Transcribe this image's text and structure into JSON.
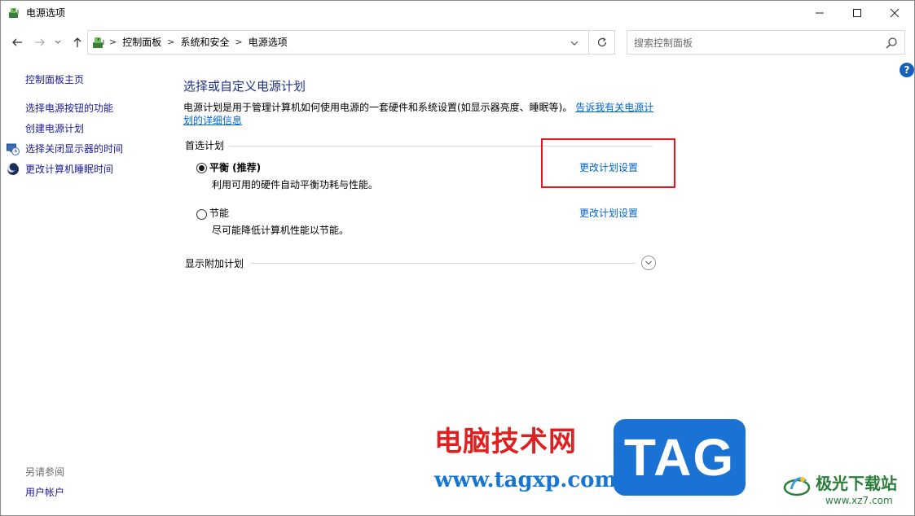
{
  "window": {
    "title": "电源选项",
    "icon": "power-options-icon",
    "controls": [
      "minimize-icon",
      "maximize-icon",
      "close-icon"
    ]
  },
  "nav": {
    "back_icon": "back-arrow-icon",
    "forward_icon": "forward-arrow-icon",
    "recent_icon": "chevron-down-icon",
    "up_icon": "up-arrow-icon"
  },
  "address": {
    "breadcrumbs": [
      "控制面板",
      "系统和安全",
      "电源选项"
    ],
    "separator": ">",
    "dropdown_icon": "chevron-down-icon",
    "refresh_icon": "refresh-icon"
  },
  "search": {
    "placeholder": "搜索控制面板",
    "icon": "search-icon"
  },
  "help": {
    "label": "?"
  },
  "sidebar": {
    "home": "控制面板主页",
    "links": [
      {
        "label": "选择电源按钮的功能"
      },
      {
        "label": "创建电源计划"
      },
      {
        "label": "选择关闭显示器的时间",
        "icon": "display-clock-icon"
      },
      {
        "label": "更改计算机睡眠时间",
        "icon": "moon-icon"
      }
    ],
    "see_also_title": "另请参阅",
    "see_also_links": [
      {
        "label": "用户帐户"
      }
    ]
  },
  "main": {
    "title": "选择或自定义电源计划",
    "intro_text": "电源计划是用于管理计算机如何使用电源的一套硬件和系统设置(如显示器亮度、睡眠等)。",
    "intro_link": "告诉我有关电源计划的详细信息",
    "preferred_label": "首选计划",
    "plans": [
      {
        "name": "平衡 (推荐)",
        "description": "利用可用的硬件自动平衡功耗与性能。",
        "selected": true,
        "link": "更改计划设置"
      },
      {
        "name": "节能",
        "description": "尽可能降低计算机性能以节能。",
        "selected": false,
        "link": "更改计划设置"
      }
    ],
    "more_plans_label": "显示附加计划",
    "expand_icon": "chevron-down-circle-icon",
    "highlight_color": "#e8141c"
  },
  "watermark": {
    "site_name": "电脑技术网",
    "site_url": "www.tagxp.com",
    "tag": "TAG",
    "logo_name": "极光下载站",
    "logo_url": "www.xz7.com",
    "colors": {
      "red": "#e02020",
      "blue": "#1776d1",
      "tag_bg": "#1a72d4",
      "green": "#2a7e3a"
    }
  }
}
